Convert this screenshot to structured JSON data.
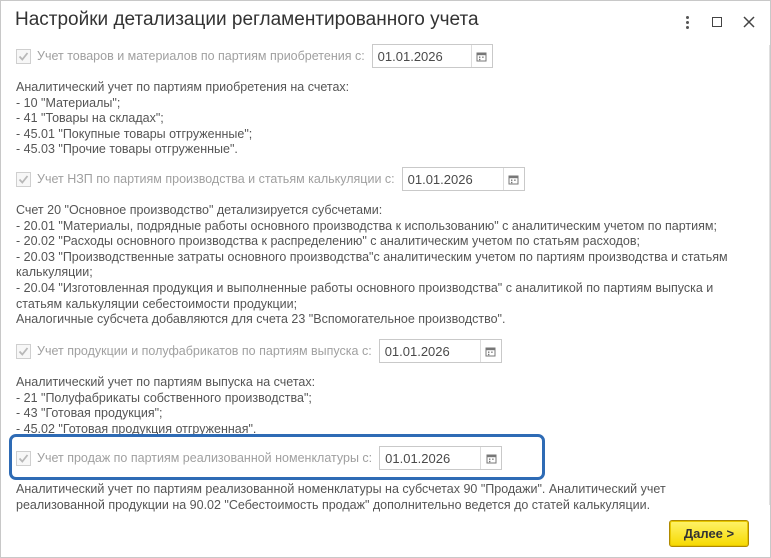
{
  "window": {
    "title": "Настройки детализации регламентированного учета",
    "menu_icon": "more-vertical-icon",
    "maximize_icon": "maximize-icon",
    "close_icon": "close-icon"
  },
  "sections": [
    {
      "checkbox_label": "Учет товаров и материалов по партиям приобретения с:",
      "checked": true,
      "date": "01.01.2026",
      "description": [
        "Аналитический учет по партиям приобретения на счетах:",
        "- 10 \"Материалы\";",
        "- 41 \"Товары на складах\";",
        "- 45.01 \"Покупные товары отгруженные\";",
        "- 45.03 \"Прочие товары отгруженные\"."
      ]
    },
    {
      "checkbox_label": "Учет НЗП по партиям производства и статьям калькуляции с:",
      "checked": true,
      "date": "01.01.2026",
      "description": [
        "Счет 20 \"Основное производство\" детализируется субсчетами:",
        "- 20.01 \"Материалы, подрядные работы основного производства к использованию\" с аналитическим учетом по партиям;",
        "- 20.02 \"Расходы основного производства к распределению\" с аналитическим учетом по статьям расходов;",
        "- 20.03 \"Производственные затраты основного производства\"с аналитическим учетом по партиям производства и статьям калькуляции;",
        "- 20.04 \"Изготовленная продукция и выполненные работы основного производства\" с аналитикой по партиям выпуска и статьям калькуляции себестоимости продукции;",
        "Аналогичные субсчета добавляются для счета 23 \"Вспомогательное производство\"."
      ]
    },
    {
      "checkbox_label": "Учет продукции и полуфабрикатов по партиям выпуска с:",
      "checked": true,
      "date": "01.01.2026",
      "description": [
        "Аналитический учет по партиям выпуска на счетах:",
        "- 21 \"Полуфабрикаты собственного производства\";",
        "- 43 \"Готовая продукция\";",
        "- 45.02 \"Готовая продукция отгруженная\"."
      ]
    },
    {
      "checkbox_label": "Учет продаж по партиям реализованной номенклатуры с:",
      "checked": true,
      "date": "01.01.2026",
      "description": [
        "Аналитический учет по партиям реализованной номенклатуры на субсчетах 90 \"Продажи\". Аналитический учет реализованной продукции на 90.02 \"Себестоимость продаж\" дополнительно ведется до статей калькуляции."
      ]
    }
  ],
  "footer": {
    "next_label": "Далее >"
  },
  "colors": {
    "highlight": "#2e6bb5",
    "next_button": "#f6d900",
    "disabled_text": "#a0a0a0"
  }
}
